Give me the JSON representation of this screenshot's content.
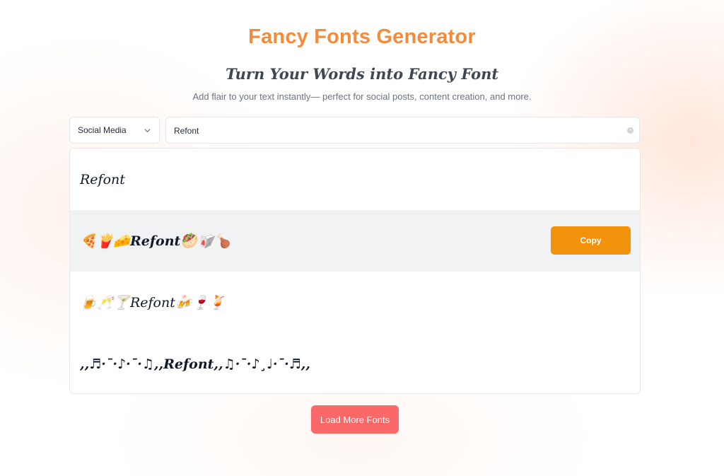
{
  "header": {
    "title": "Fancy Fonts Generator",
    "subtitle": "Turn Your Words into Fancy Font",
    "tagline": "Add flair to your text instantly— perfect for social posts, content creation, and more."
  },
  "controls": {
    "category_selected": "Social Media",
    "input_value": "Refont",
    "clear_symbol": "×"
  },
  "results": [
    {
      "text": "𝑅𝑒𝑓𝑜𝑛𝑡"
    },
    {
      "text": "🍕🍟🧀𝑹𝒆𝒇𝒐𝒏𝒕🥙🥡🍗"
    },
    {
      "text": "🍺🥂🍸𝑅𝑒𝑓𝑜𝑛𝑡🍻🍷🍹"
    },
    {
      "text": ",,♬·¯·♪·¯·♫,,𝑹𝒆𝒇𝒐𝒏𝒕,,♫·¯·♪¸♩·¯·♬,,"
    }
  ],
  "copy_label": "Copy",
  "load_more_label": "Load More Fonts",
  "colors": {
    "title": "#f28b3c",
    "copy_button": "#f2920b",
    "load_more_button": "#fa6868",
    "active_row": "#f1f2f4"
  }
}
